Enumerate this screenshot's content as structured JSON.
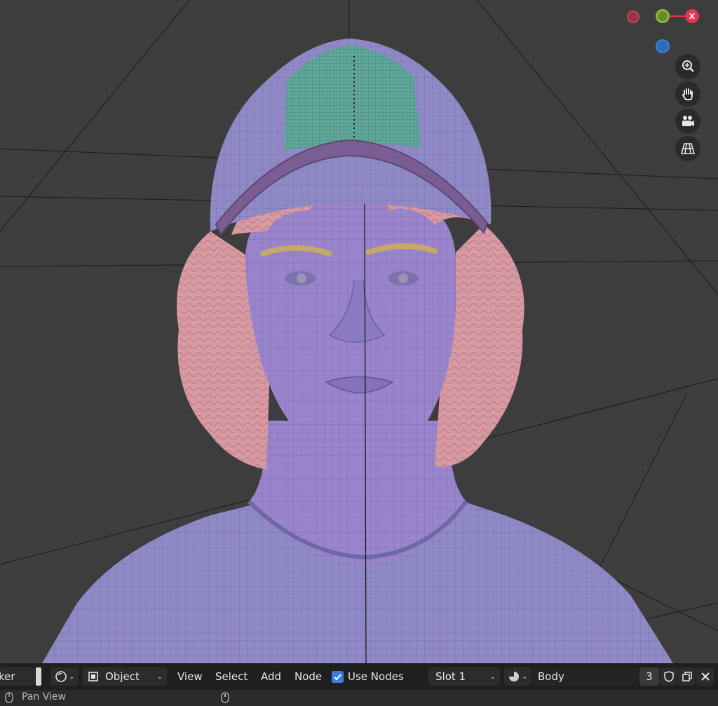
{
  "header": {
    "editor_partial_label": "ker",
    "object_mode_label": "Object",
    "menus": [
      "View",
      "Select",
      "Add",
      "Node"
    ],
    "use_nodes_label": "Use Nodes",
    "use_nodes_checked": true,
    "slot_label": "Slot 1",
    "material_name": "Body",
    "user_count": "3"
  },
  "gizmo": {
    "x_label": "X"
  },
  "status_bar": {
    "pan_view_label": "Pan View"
  },
  "colors": {
    "viewport_bg": "#3d3d3d",
    "header_bg": "#1f1f1f",
    "mesh_body": "#9488cc",
    "cap_panel": "#5fa89a",
    "hair": "#d79aa3",
    "brows": "#c6a86a",
    "accent_blue": "#3b7ddd"
  }
}
